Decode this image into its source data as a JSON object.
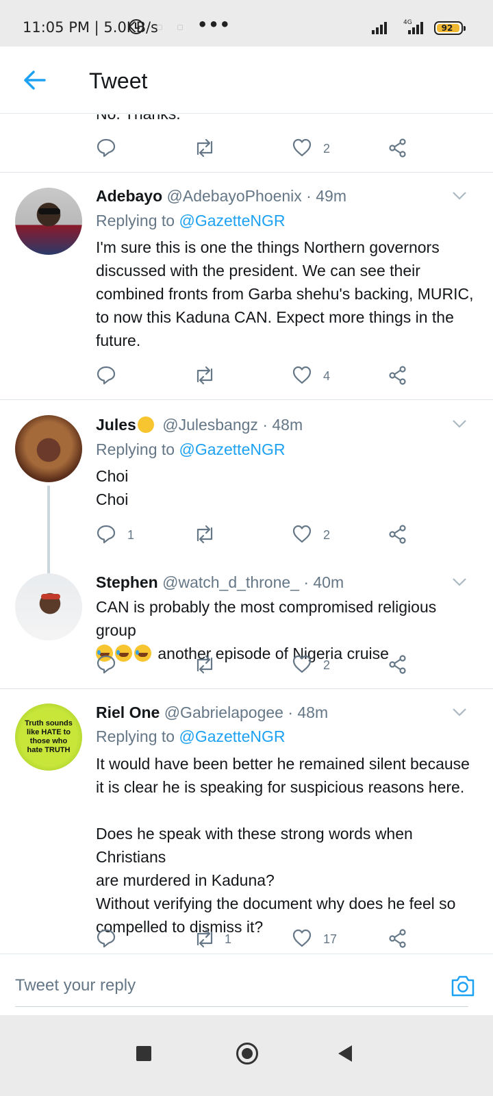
{
  "status_bar": {
    "time": "11:05 PM | 5.0KB/s",
    "network": "4G",
    "battery": "92"
  },
  "header": {
    "title": "Tweet"
  },
  "partial_tweet": {
    "text_cut": "No. Thanks.",
    "like_count": "2"
  },
  "tweets": [
    {
      "name": "Adebayo",
      "handle": "@AdebayoPhoenix · 49m",
      "replying_prefix": "Replying to ",
      "replying_to": "@GazetteNGR",
      "lines": [
        "I'm sure this is one the things Northern governors",
        "discussed with the president. We can see their",
        "combined fronts from Garba shehu's backing, MURIC,",
        "to now this Kaduna CAN. Expect more things in the",
        "future."
      ],
      "like_count": "4"
    },
    {
      "name": "Jules",
      "handle": "@Julesbangz · 48m",
      "replying_prefix": "Replying to ",
      "replying_to": "@GazetteNGR",
      "lines": [
        "Choi",
        "Choi"
      ],
      "reply_count": "1",
      "like_count": "2"
    },
    {
      "name": "Stephen",
      "handle": "@watch_d_throne_ · 40m",
      "lines": [
        "CAN is probably the most compromised religious group",
        "another episode of Nigeria cruise"
      ],
      "like_count": "2"
    },
    {
      "name": "Riel One",
      "handle": "@Gabrielapogee · 48m",
      "replying_prefix": "Replying to ",
      "replying_to": "@GazetteNGR",
      "avatar_text": "Truth sounds like HATE to those who hate TRUTH",
      "lines": [
        "It would have been better he remained silent because",
        "it is clear he is speaking for suspicious reasons here.",
        "",
        "Does he speak with these strong words when Christians",
        "are murdered in Kaduna?",
        "Without verifying the document why does he feel so",
        "compelled to dismiss it?"
      ],
      "retweet_count": "1",
      "like_count": "17"
    }
  ],
  "reply_box": {
    "placeholder": "Tweet your reply"
  },
  "colors": {
    "accent": "#1da1f2",
    "muted": "#657786",
    "text": "#14171a"
  }
}
